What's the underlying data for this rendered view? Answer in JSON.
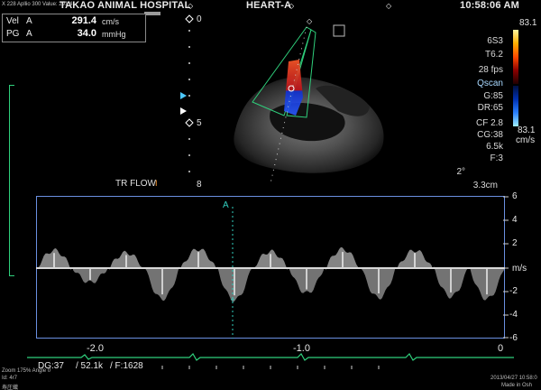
{
  "header": {
    "tiny_line": "X 228 Apllio 300  Value: 291.4",
    "software": "Aplio 300",
    "hospital": "TAKAO ANIMAL HOSPITAL",
    "preset": "HEART-A",
    "time": "10:58:06 AM"
  },
  "measurements": [
    {
      "label": "Vel",
      "channel": "A",
      "value": "291.4",
      "unit": "cm/s"
    },
    {
      "label": "PG",
      "channel": "A",
      "value": "34.0",
      "unit": "mmHg"
    }
  ],
  "image_params": [
    "6S3",
    "T6.2",
    "28 fps",
    "Qscan",
    "G:85",
    "DR:65",
    "CF 2.8",
    "CG:38",
    "6.5k",
    "F:3",
    "2°",
    "3.3cm"
  ],
  "color_scale": {
    "top": "83.1",
    "bottom": "83.1",
    "unit": "cm/s"
  },
  "depth_marks": [
    "0",
    "5",
    "8"
  ],
  "flow_label": "TR FLOW",
  "cursor_label": "A",
  "doppler": {
    "unit": "m/s",
    "y_ticks": [
      "6",
      "4",
      "2",
      "",
      "-2",
      "-4",
      "-6"
    ],
    "x_ticks": [
      "-2.0",
      "-1.0",
      "0"
    ]
  },
  "status": {
    "dg": "DG:37",
    "prf": "/ 52.1k",
    "frame": "/ F:1628"
  },
  "footer": {
    "zoom": "Zoom 175%  Angle 0",
    "id": "Id: 4r7",
    "name": "寿圧織",
    "date": "2013/04/27 10:58:0",
    "made": "Made in Osh"
  },
  "chart_data": {
    "type": "line",
    "title": "",
    "xlabel": "",
    "ylabel": "m/s",
    "xlim": [
      -2.5,
      0.1
    ],
    "ylim": [
      -6,
      6
    ],
    "x_ticks": [
      -2.0,
      -1.0,
      0
    ],
    "y_ticks": [
      6,
      4,
      2,
      -2,
      -4,
      -6
    ],
    "series": [
      {
        "values_desc": "",
        "x": [
          -2.4,
          -2.2,
          -2.0,
          -1.8,
          -1.6,
          -1.4,
          -1.2,
          -1.0,
          -0.8,
          -0.6,
          -0.4,
          -0.2,
          0.0
        ],
        "y": [
          1.5,
          -1.2,
          1.3,
          -2.6,
          1.6,
          -2.7,
          1.4,
          -2.1,
          1.6,
          -2.5,
          1.5,
          -2.4,
          -2.6
        ]
      }
    ]
  },
  "colors": {
    "accent": "#6aa0ff",
    "ecg": "#2fd07c",
    "cursor": "#32d0c0",
    "scale_box": "#6a8fe0"
  }
}
